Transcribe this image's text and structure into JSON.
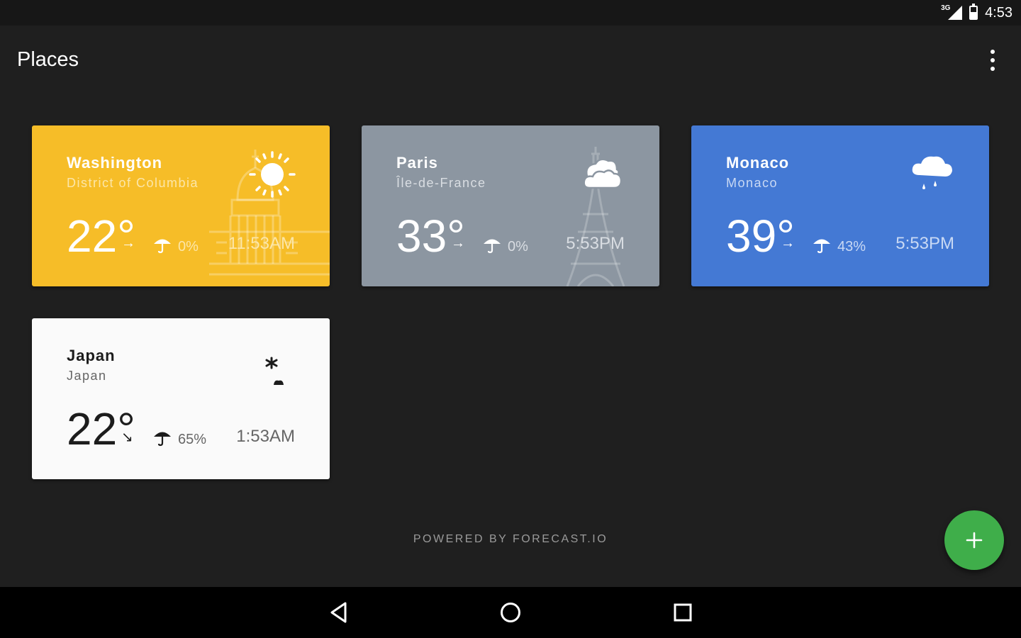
{
  "status": {
    "network": "3G",
    "time": "4:53"
  },
  "appbar": {
    "title": "Places"
  },
  "places": [
    {
      "name": "Washington",
      "region": "District of Columbia",
      "temp": "22°",
      "trend": "→",
      "precip": "0%",
      "local_time": "11:53AM",
      "condition_icon": "sun-icon",
      "landmark_icon": "capitol-icon",
      "bg": "#f6bd28",
      "fg": "#ffffff",
      "sub": "#fce6a8"
    },
    {
      "name": "Paris",
      "region": "Île-de-France",
      "temp": "33°",
      "trend": "→",
      "precip": "0%",
      "local_time": "5:53PM",
      "condition_icon": "cloudy-icon",
      "landmark_icon": "eiffel-tower-icon",
      "bg": "#8c96a1",
      "fg": "#ffffff",
      "sub": "#d9dde2"
    },
    {
      "name": "Monaco",
      "region": "Monaco",
      "temp": "39°",
      "trend": "→",
      "precip": "43%",
      "local_time": "5:53PM",
      "condition_icon": "rain-icon",
      "bg": "#4479d4",
      "fg": "#ffffff",
      "sub": "#c9d9f4"
    },
    {
      "name": "Japan",
      "region": "Japan",
      "temp": "22°",
      "trend": "↘",
      "precip": "65%",
      "local_time": "1:53AM",
      "condition_icon": "night-icon",
      "bg": "#fafafa",
      "fg": "#1c1c1c",
      "sub": "#666666"
    }
  ],
  "footer": {
    "credit": "POWERED BY FORECAST.IO"
  },
  "fab": {
    "icon": "add-icon",
    "color": "#3fae4a"
  },
  "navbar": {
    "icons": [
      "back-icon",
      "home-icon",
      "recents-icon"
    ]
  }
}
